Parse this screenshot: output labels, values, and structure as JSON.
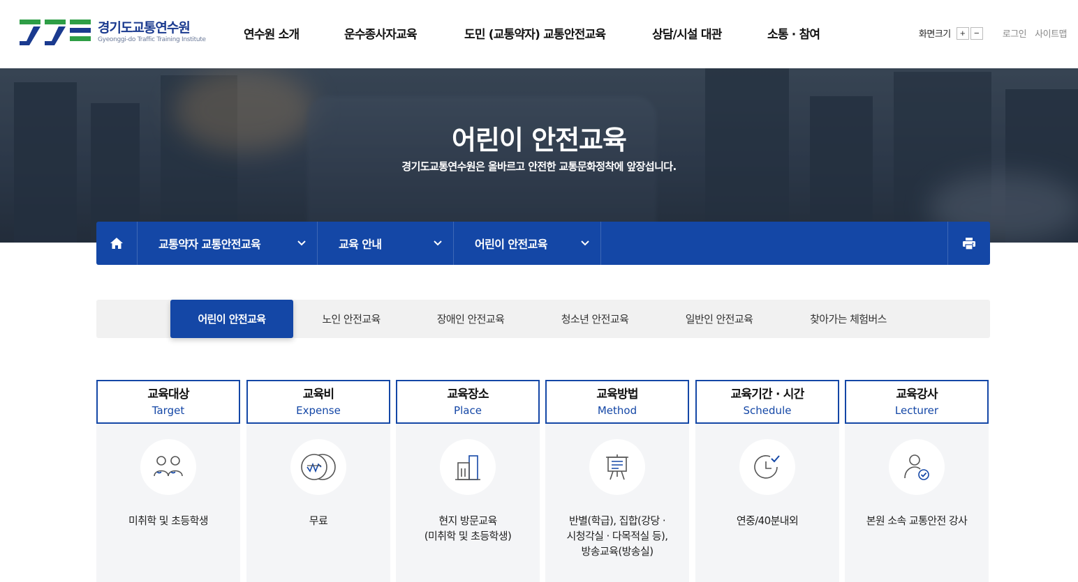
{
  "header": {
    "logo": {
      "name_ko": "경기도교통연수원",
      "name_en": "Gyeonggi-do Traffic Training Institute"
    },
    "nav": [
      "연수원 소개",
      "운수종사자교육",
      "도민 (교통약자) 교통안전교육",
      "상담/시설 대관",
      "소통 · 참여"
    ],
    "util": {
      "font_size_label": "화면크기",
      "plus": "+",
      "minus": "−",
      "login": "로그인",
      "sitemap": "사이트맵"
    }
  },
  "hero": {
    "title": "어린이 안전교육",
    "subtitle": "경기도교통연수원은 올바르고 안전한 교통문화정착에 앞장섭니다."
  },
  "location": {
    "crumbs": [
      "교통약자 교통안전교육",
      "교육 안내",
      "어린이 안전교육"
    ]
  },
  "tabs": {
    "items": [
      "어린이 안전교육",
      "노인 안전교육",
      "장애인 안전교육",
      "청소년 안전교육",
      "일반인 안전교육",
      "찾아가는 체험버스"
    ],
    "active": 0
  },
  "cards": [
    {
      "title": "교육대상",
      "title_en": "Target",
      "icon": "people-icon",
      "desc_lines": [
        "미취학 및 초등학생"
      ]
    },
    {
      "title": "교육비",
      "title_en": "Expense",
      "icon": "coin-icon",
      "desc_lines": [
        "무료"
      ]
    },
    {
      "title": "교육장소",
      "title_en": "Place",
      "icon": "building-icon",
      "desc_lines": [
        "현지 방문교육",
        "(미취학 및 초등학생)"
      ]
    },
    {
      "title": "교육방법",
      "title_en": "Method",
      "icon": "presentation-board-icon",
      "desc_lines": [
        "반별(학급), 집합(강당 ·",
        "시청각실 · 다목적실 등),",
        "방송교육(방송실)"
      ]
    },
    {
      "title": "교육기간 · 시간",
      "title_en": "Schedule",
      "icon": "clock-check-icon",
      "desc_lines": [
        "연중/40분내외"
      ]
    },
    {
      "title": "교육강사",
      "title_en": "Lecturer",
      "icon": "person-check-icon",
      "desc_lines": [
        "본원 소속 교통안전 강사"
      ]
    }
  ],
  "colors": {
    "primary": "#1447a6",
    "logo_green": "#2e9e46",
    "logo_blue": "#1a3a8f",
    "card_bg": "#f4f5f7",
    "tab_bg": "#f1f1f1"
  }
}
